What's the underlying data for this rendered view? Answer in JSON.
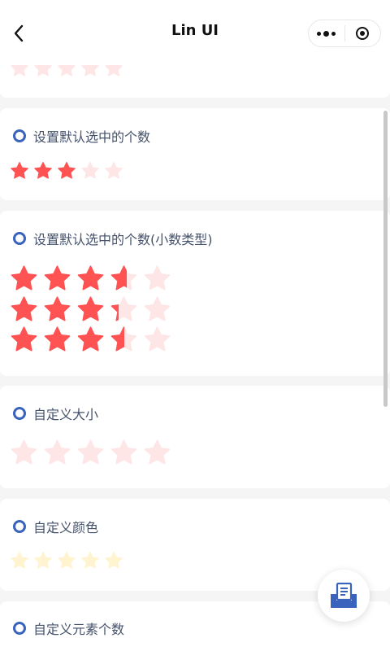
{
  "nav": {
    "title": "Lin UI"
  },
  "colors": {
    "active": "#ff5253",
    "inactive": "#ffe6e6",
    "custom_active": "#ffe08a",
    "custom_inactive": "#fff4cf",
    "ring": "#3963bc"
  },
  "sections": {
    "top_partial": {
      "values": [
        0
      ]
    },
    "default_selected": {
      "title": "设置默认选中的个数",
      "values": [
        3
      ]
    },
    "decimal_selected": {
      "title": "设置默认选中的个数(小数类型)",
      "values": [
        3.6,
        3.3,
        3.5
      ]
    },
    "custom_size": {
      "title": "自定义大小",
      "values": [
        0
      ]
    },
    "custom_color": {
      "title": "自定义颜色",
      "values": [
        0
      ]
    },
    "custom_count": {
      "title": "自定义元素个数"
    }
  },
  "fab": {
    "icon": "document-box-icon"
  }
}
